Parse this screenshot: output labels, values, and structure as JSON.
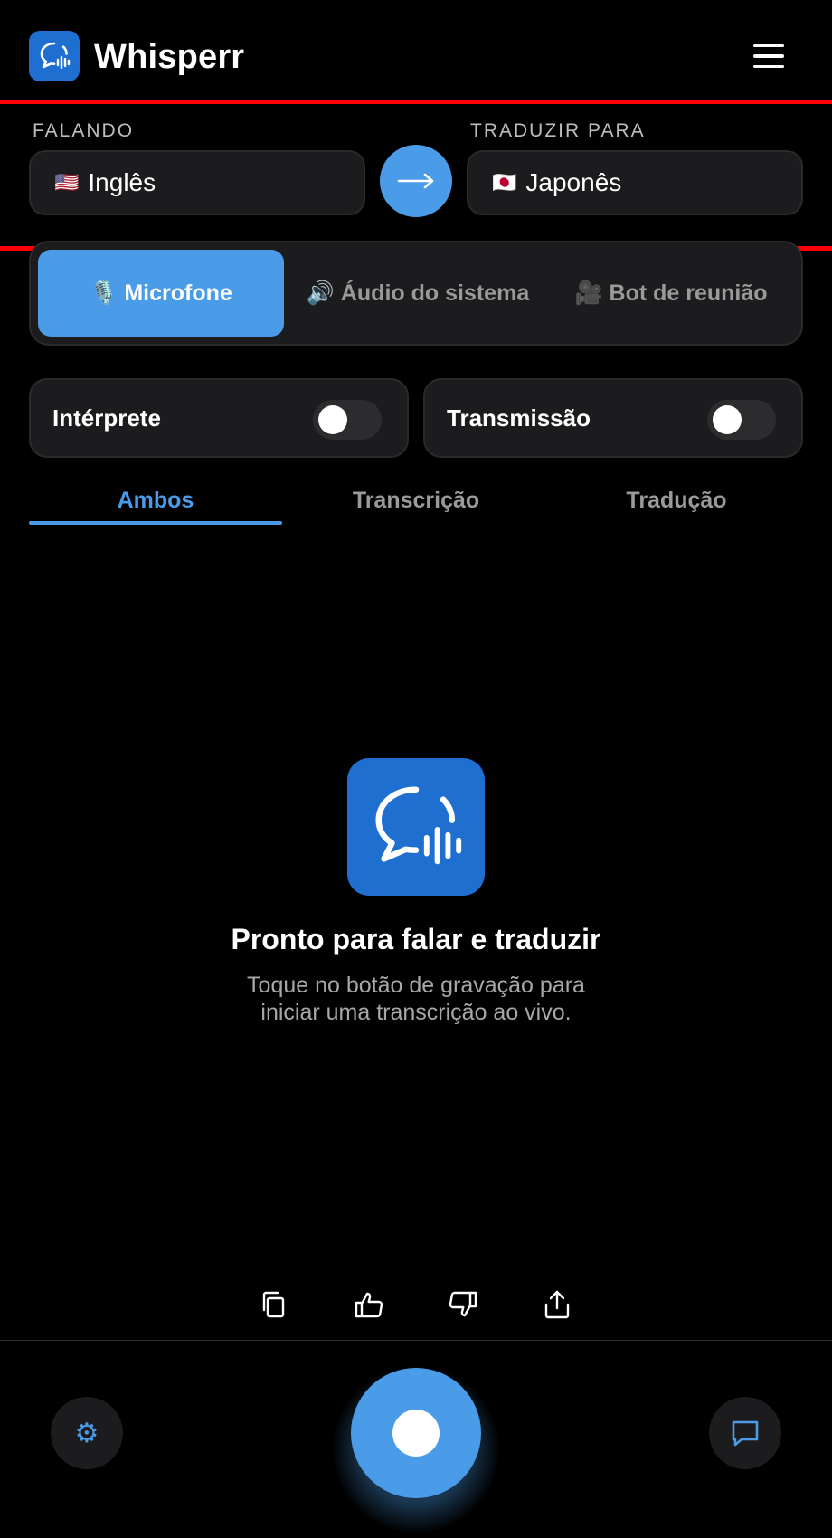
{
  "app": {
    "title": "Whisperr"
  },
  "languages": {
    "source_label": "FALANDO",
    "source_flag": "🇺🇸",
    "source_value": "Inglês",
    "target_label": "TRADUZIR PARA",
    "target_flag": "🇯🇵",
    "target_value": "Japonês",
    "swap_glyph": "→"
  },
  "sources": [
    {
      "icon": "🎙️",
      "label": "Microfone",
      "active": true
    },
    {
      "icon": "🔊",
      "label": "Áudio do sistema",
      "active": false
    },
    {
      "icon": "🎥",
      "label": "Bot de reunião",
      "active": false
    }
  ],
  "toggles": {
    "interpreter": {
      "label": "Intérprete",
      "on": false
    },
    "broadcast": {
      "label": "Transmissão",
      "on": false
    }
  },
  "view_tabs": [
    {
      "label": "Ambos",
      "active": true
    },
    {
      "label": "Transcrição",
      "active": false
    },
    {
      "label": "Tradução",
      "active": false
    }
  ],
  "empty_state": {
    "title": "Pronto para falar e traduzir",
    "subtitle_line1": "Toque no botão de gravação para",
    "subtitle_line2": "iniciar uma transcrição ao vivo."
  },
  "actions": [
    "copy-icon",
    "thumbs-up-icon",
    "thumbs-down-icon",
    "share-icon"
  ],
  "bottom_bar": {
    "settings_glyph": "⚙",
    "record_state": "idle"
  },
  "colors": {
    "accent": "#4a9ce8",
    "brand": "#1f6fd1",
    "surface": "#1c1c1e",
    "annotation": "#ff0000"
  }
}
